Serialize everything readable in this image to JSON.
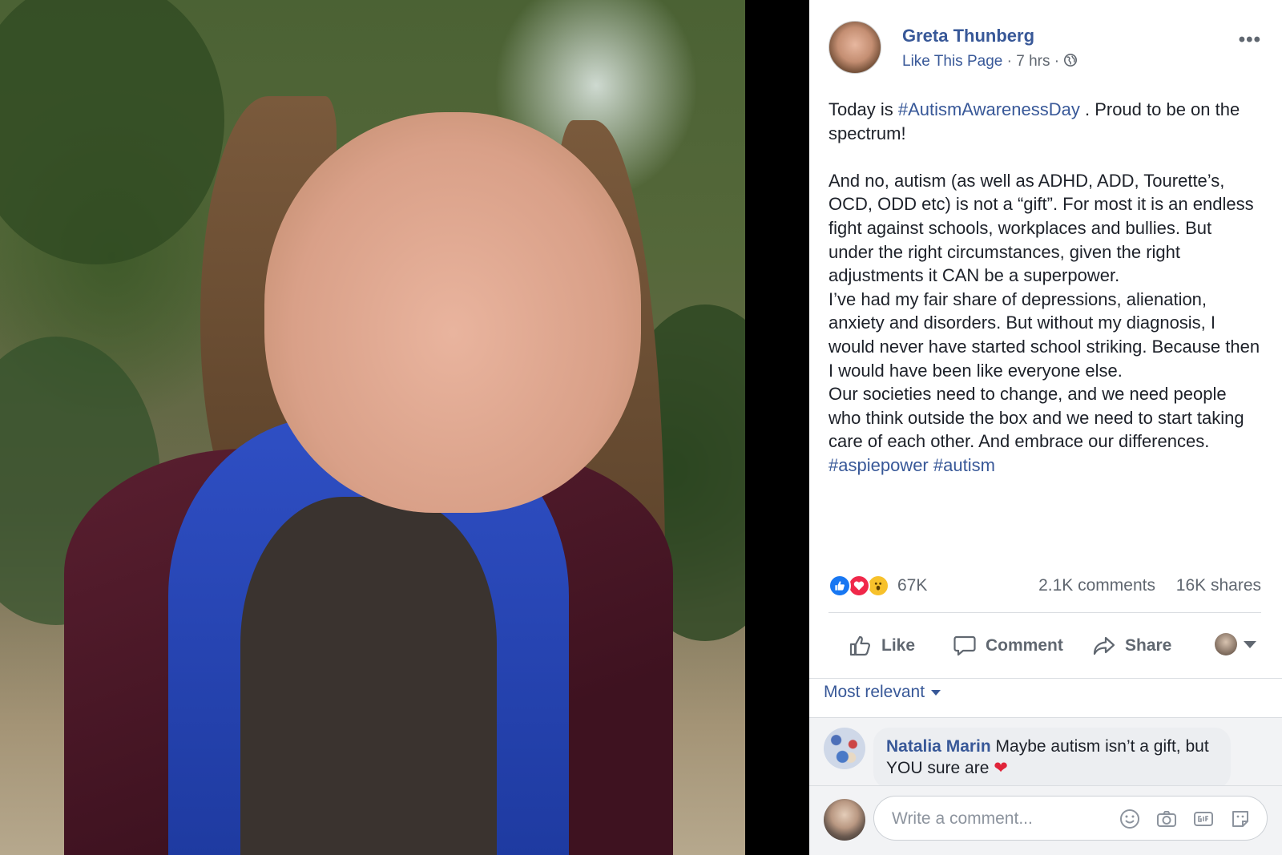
{
  "post": {
    "author": "Greta Thunberg",
    "like_page": "Like This Page",
    "time": "7 hrs",
    "separator": "·",
    "more": "•••",
    "text": {
      "line1_prefix": "Today is ",
      "line1_hashtag": "#AutismAwarenessDay",
      "line1_suffix": " . Proud to be on the spectrum!",
      "para2": "And no, autism (as well as ADHD, ADD, Tourette’s, OCD, ODD etc) is not a “gift”. For most it is an endless fight against schools, workplaces and bullies. But under the right circumstances, given the right adjustments it CAN be a superpower.",
      "para3": "I’ve had my fair share of depressions, alienation, anxiety and disorders. But without my diagnosis, I would never have started school striking. Because then I would have been like everyone else.",
      "para4": "Our societies need to change, and we need people who think outside the box and we need to start taking care of each other. And embrace our differences. ",
      "hashtag2": "#aspiepower",
      "hashtag3": "#autism"
    }
  },
  "stats": {
    "reactions_count": "67K",
    "comments": "2.1K comments",
    "shares": "16K shares"
  },
  "actions": {
    "like": "Like",
    "comment": "Comment",
    "share": "Share"
  },
  "sort": {
    "label": "Most relevant"
  },
  "comments": [
    {
      "author": "Natalia Marin",
      "text": " Maybe autism isn’t a gift, but YOU sure are ",
      "emoji": "❤"
    }
  ],
  "composer": {
    "placeholder": "Write a comment..."
  },
  "colors": {
    "link_blue": "#385898",
    "secondary_text": "#606770",
    "like_blue": "#1877f2",
    "love_red": "#f0284a",
    "wow_yellow": "#f7c12b"
  },
  "icons": [
    "globe-icon",
    "more-icon",
    "like-reaction-icon",
    "love-reaction-icon",
    "wow-reaction-icon",
    "thumbs-up-icon",
    "speech-bubble-icon",
    "share-arrow-icon",
    "caret-down-icon",
    "smiley-icon",
    "camera-icon",
    "gif-icon",
    "sticker-icon"
  ]
}
